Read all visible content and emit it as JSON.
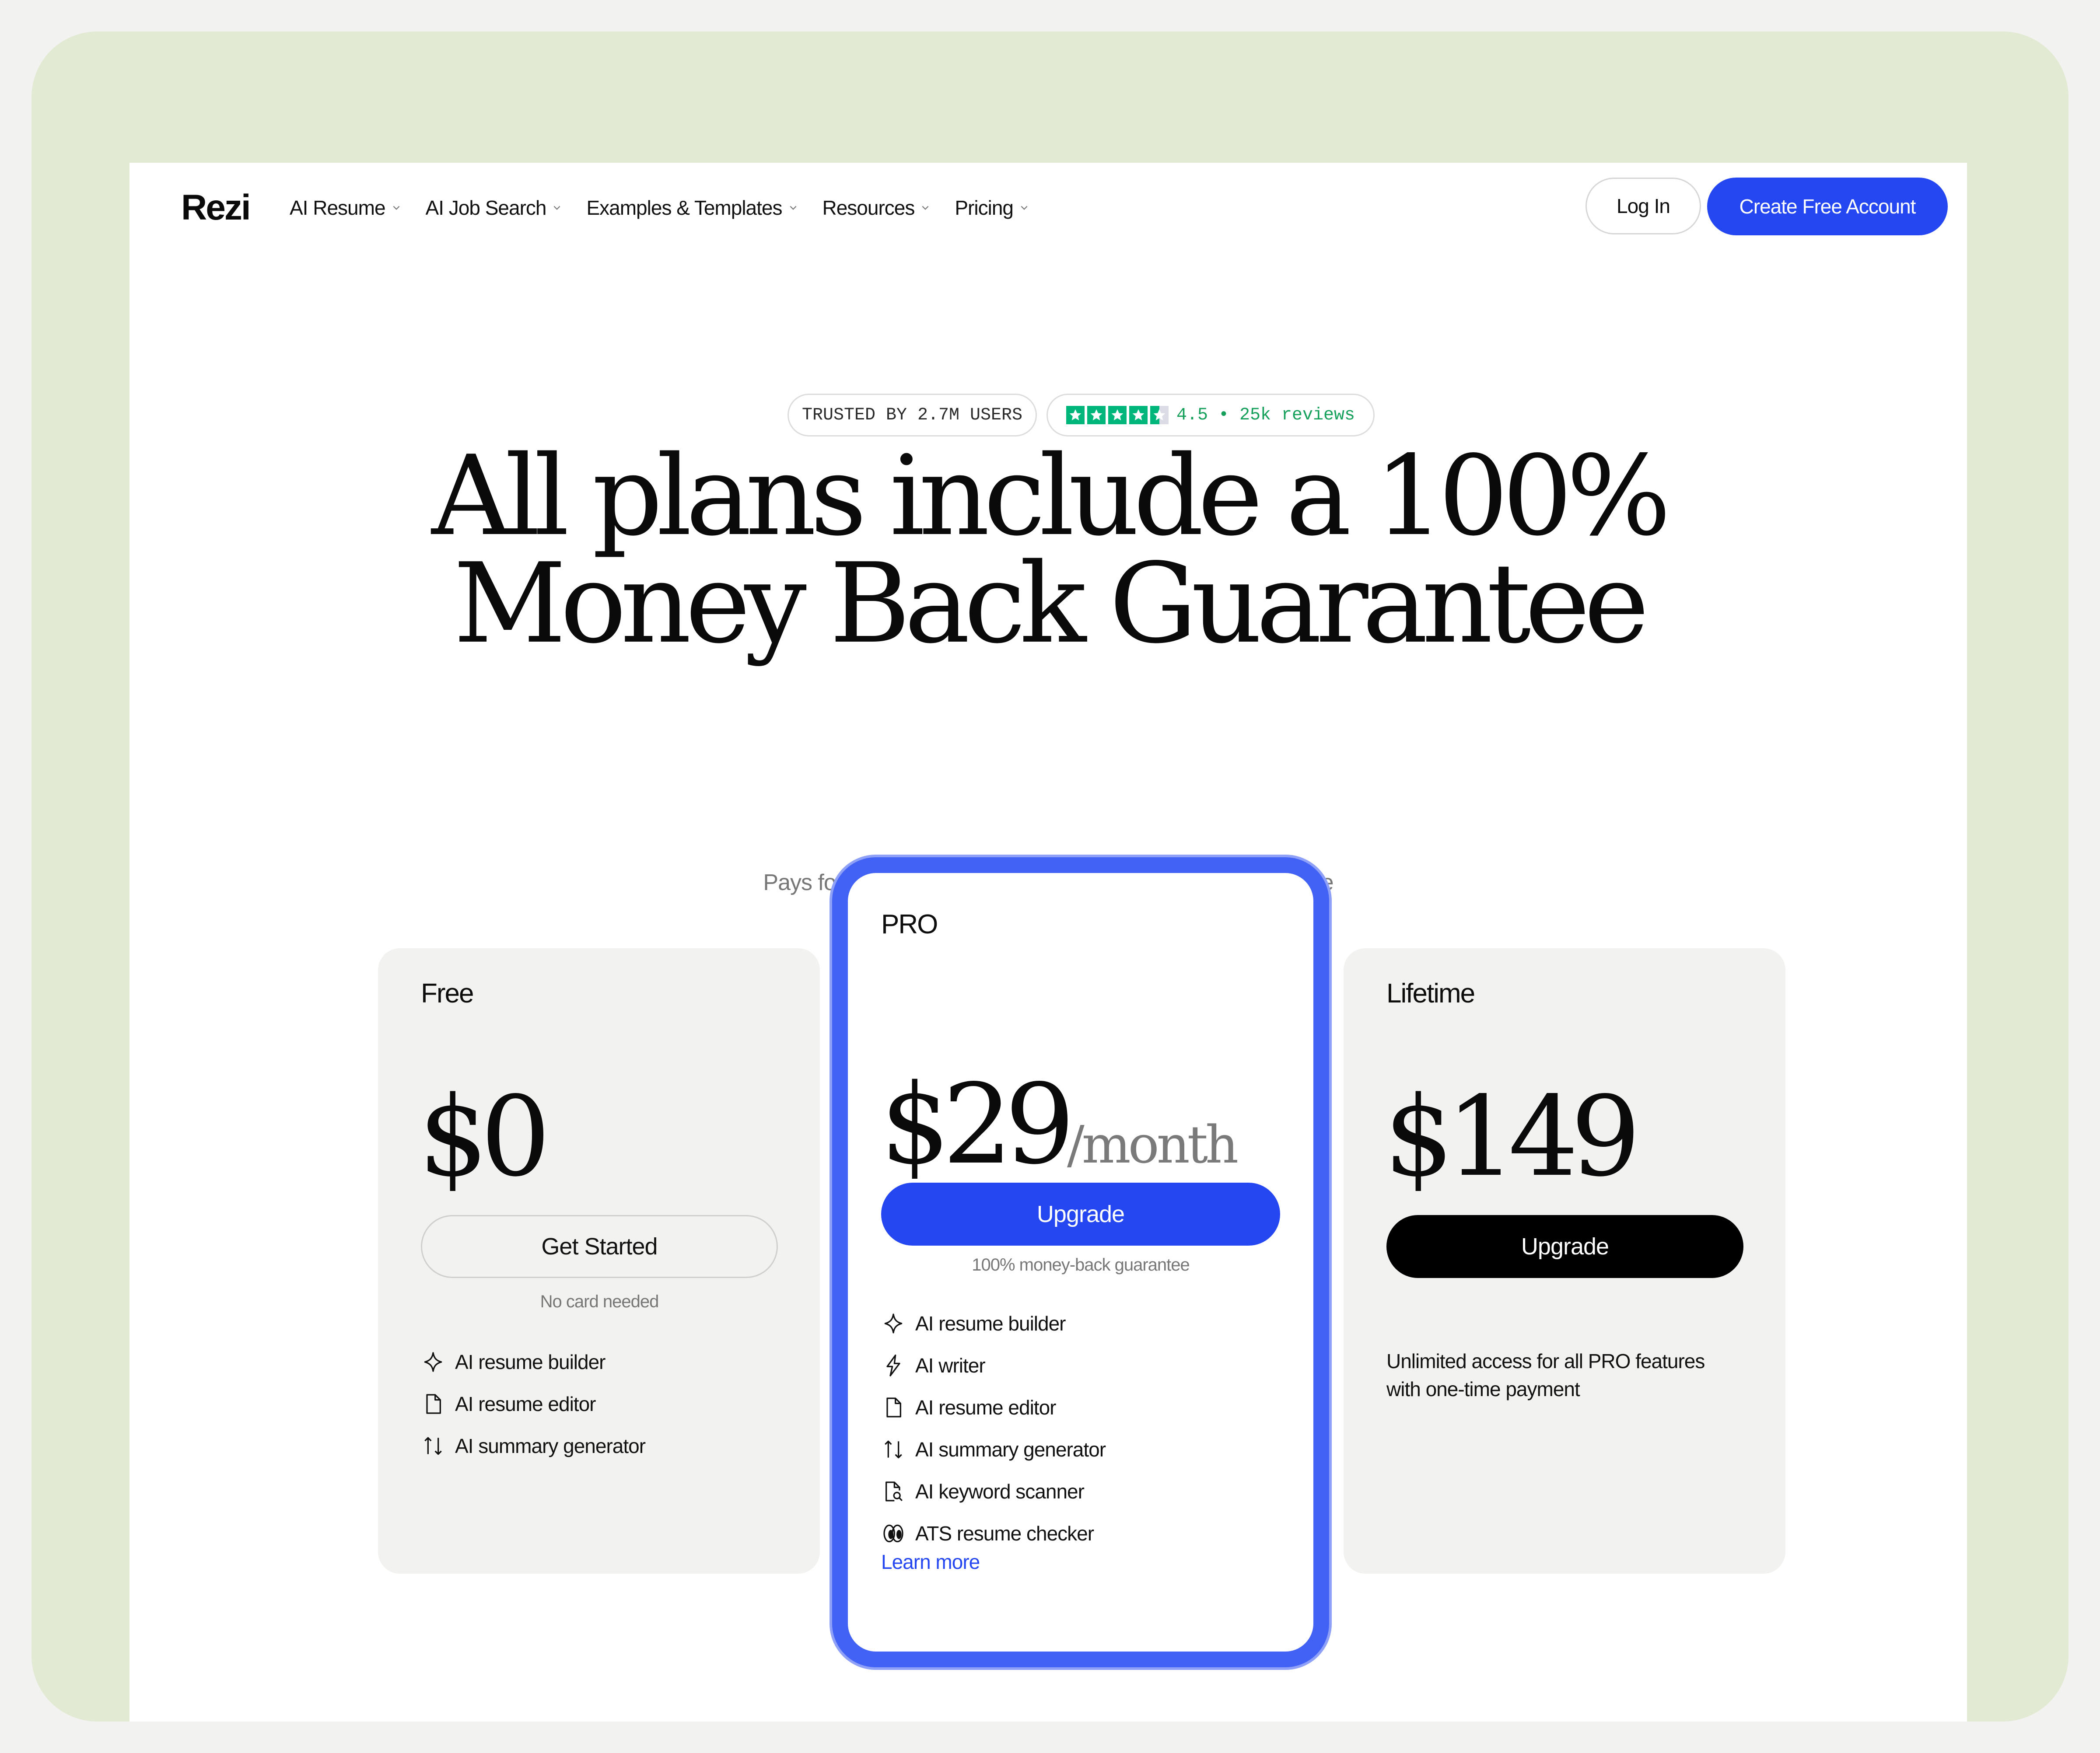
{
  "header": {
    "logo": "Rezi",
    "nav": [
      {
        "label": "AI Resume"
      },
      {
        "label": "AI Job Search"
      },
      {
        "label": "Examples & Templates"
      },
      {
        "label": "Resources"
      },
      {
        "label": "Pricing"
      }
    ],
    "login_label": "Log In",
    "create_account_label": "Create Free Account"
  },
  "badges": {
    "trusted": "TRUSTED BY 2.7M USERS",
    "rating": "4.5 • 25k reviews"
  },
  "hero": {
    "title_line1": "All plans include a 100%",
    "title_line2": "Money Back Guarantee",
    "subtitle": "Pays for itself with the time you’ll save creating one resume"
  },
  "plans": {
    "free": {
      "name": "Free",
      "price": "$0",
      "button": "Get Started",
      "note": "No card needed",
      "features": [
        "AI resume builder",
        "AI resume editor",
        "AI summary generator"
      ]
    },
    "pro": {
      "name": "PRO",
      "price": "$29",
      "period": "/month",
      "button": "Upgrade",
      "note": "100% money-back guarantee",
      "features": [
        "AI resume builder",
        "AI writer",
        "AI resume editor",
        "AI summary generator",
        "AI keyword scanner",
        "ATS resume checker"
      ],
      "learn_more": "Learn more"
    },
    "lifetime": {
      "name": "Lifetime",
      "price": "$149",
      "button": "Upgrade",
      "description": "Unlimited access for all PRO features with one-time payment"
    }
  },
  "colors": {
    "brand_blue": "#2547f2",
    "frame_green": "#e3ead4",
    "trustpilot_green": "#00b67a"
  }
}
